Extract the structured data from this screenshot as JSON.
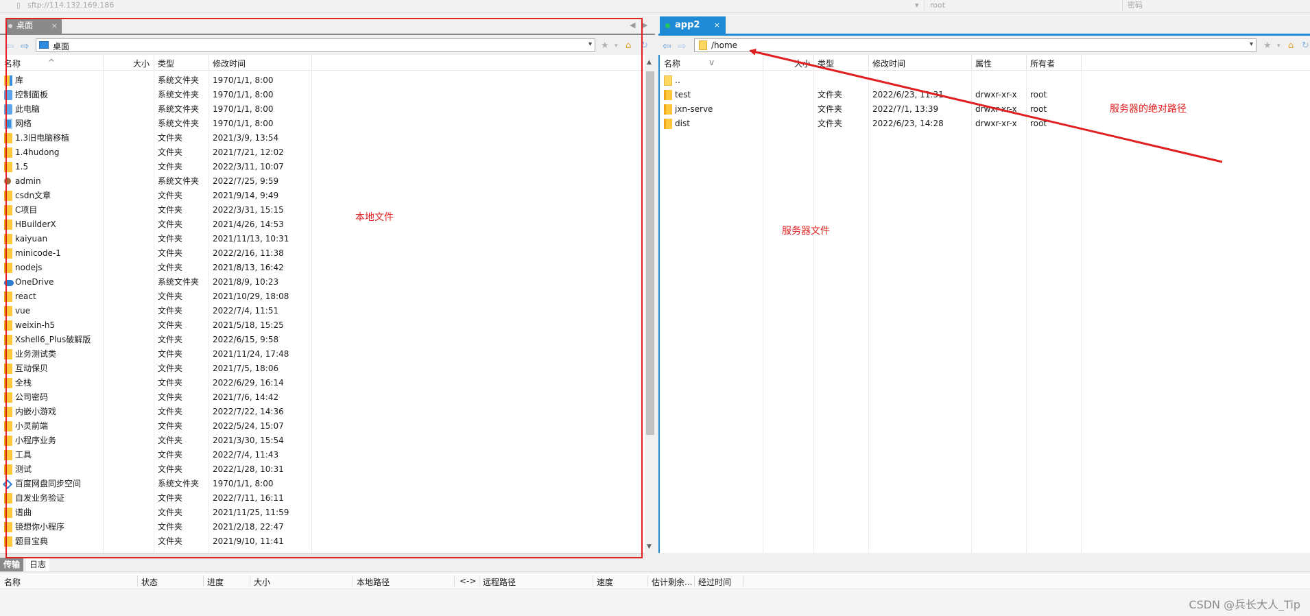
{
  "top_bar": {
    "address": "sftp://114.132.169.186",
    "user": "root",
    "password_label": "密码"
  },
  "local_tab": {
    "label": "桌面",
    "close": "×"
  },
  "remote_tab": {
    "label": "app2",
    "close": "×"
  },
  "local_path": "桌面",
  "remote_path": "/home",
  "columns_local": {
    "name": "名称",
    "size": "大小",
    "type": "类型",
    "modified": "修改时间"
  },
  "columns_remote": {
    "name": "名称",
    "size": "大小",
    "type": "类型",
    "modified": "修改时间",
    "attrs": "属性",
    "owner": "所有者"
  },
  "local_files": [
    {
      "name": "库",
      "type": "系统文件夹",
      "modified": "1970/1/1, 8:00",
      "icon": "lib"
    },
    {
      "name": "控制面板",
      "type": "系统文件夹",
      "modified": "1970/1/1, 8:00",
      "icon": "sys"
    },
    {
      "name": "此电脑",
      "type": "系统文件夹",
      "modified": "1970/1/1, 8:00",
      "icon": "sys"
    },
    {
      "name": "网络",
      "type": "系统文件夹",
      "modified": "1970/1/1, 8:00",
      "icon": "net"
    },
    {
      "name": "1.3旧电脑移植",
      "type": "文件夹",
      "modified": "2021/3/9, 13:54",
      "icon": "folder"
    },
    {
      "name": "1.4hudong",
      "type": "文件夹",
      "modified": "2021/7/21, 12:02",
      "icon": "folder"
    },
    {
      "name": "1.5",
      "type": "文件夹",
      "modified": "2022/3/11, 10:07",
      "icon": "folder"
    },
    {
      "name": "admin",
      "type": "系统文件夹",
      "modified": "2022/7/25, 9:59",
      "icon": "user"
    },
    {
      "name": "csdn文章",
      "type": "文件夹",
      "modified": "2021/9/14, 9:49",
      "icon": "folder"
    },
    {
      "name": "C项目",
      "type": "文件夹",
      "modified": "2022/3/31, 15:15",
      "icon": "folder"
    },
    {
      "name": "HBuilderX",
      "type": "文件夹",
      "modified": "2021/4/26, 14:53",
      "icon": "folder"
    },
    {
      "name": "kaiyuan",
      "type": "文件夹",
      "modified": "2021/11/13, 10:31",
      "icon": "folder"
    },
    {
      "name": "minicode-1",
      "type": "文件夹",
      "modified": "2022/2/16, 11:38",
      "icon": "folder"
    },
    {
      "name": "nodejs",
      "type": "文件夹",
      "modified": "2021/8/13, 16:42",
      "icon": "folder"
    },
    {
      "name": "OneDrive",
      "type": "系统文件夹",
      "modified": "2021/8/9, 10:23",
      "icon": "cloud"
    },
    {
      "name": "react",
      "type": "文件夹",
      "modified": "2021/10/29, 18:08",
      "icon": "folder"
    },
    {
      "name": "vue",
      "type": "文件夹",
      "modified": "2022/7/4, 11:51",
      "icon": "folder"
    },
    {
      "name": "weixin-h5",
      "type": "文件夹",
      "modified": "2021/5/18, 15:25",
      "icon": "folder"
    },
    {
      "name": "Xshell6_Plus破解版",
      "type": "文件夹",
      "modified": "2022/6/15, 9:58",
      "icon": "folder"
    },
    {
      "name": "业务测试类",
      "type": "文件夹",
      "modified": "2021/11/24, 17:48",
      "icon": "folder"
    },
    {
      "name": "互动保贝",
      "type": "文件夹",
      "modified": "2021/7/5, 18:06",
      "icon": "folder"
    },
    {
      "name": "全栈",
      "type": "文件夹",
      "modified": "2022/6/29, 16:14",
      "icon": "folder"
    },
    {
      "name": "公司密码",
      "type": "文件夹",
      "modified": "2021/7/6, 14:42",
      "icon": "folder"
    },
    {
      "name": "内嵌小游戏",
      "type": "文件夹",
      "modified": "2022/7/22, 14:36",
      "icon": "folder"
    },
    {
      "name": "小灵前端",
      "type": "文件夹",
      "modified": "2022/5/24, 15:07",
      "icon": "folder"
    },
    {
      "name": "小程序业务",
      "type": "文件夹",
      "modified": "2021/3/30, 15:54",
      "icon": "folder"
    },
    {
      "name": "工具",
      "type": "文件夹",
      "modified": "2022/7/4, 11:43",
      "icon": "folder"
    },
    {
      "name": "测试",
      "type": "文件夹",
      "modified": "2022/1/28, 10:31",
      "icon": "folder"
    },
    {
      "name": "百度网盘同步空间",
      "type": "系统文件夹",
      "modified": "1970/1/1, 8:00",
      "icon": "baidu"
    },
    {
      "name": "自发业务验证",
      "type": "文件夹",
      "modified": "2022/7/11, 16:11",
      "icon": "folder"
    },
    {
      "name": "谱曲",
      "type": "文件夹",
      "modified": "2021/11/25, 11:59",
      "icon": "folder"
    },
    {
      "name": "镜想你小程序",
      "type": "文件夹",
      "modified": "2021/2/18, 22:47",
      "icon": "folder"
    },
    {
      "name": "题目宝典",
      "type": "文件夹",
      "modified": "2021/9/10, 11:41",
      "icon": "folder"
    }
  ],
  "remote_files": [
    {
      "name": "..",
      "type": "",
      "modified": "",
      "attrs": "",
      "owner": "",
      "icon": "updir"
    },
    {
      "name": "test",
      "type": "文件夹",
      "modified": "2022/6/23, 11:31",
      "attrs": "drwxr-xr-x",
      "owner": "root",
      "icon": "folder"
    },
    {
      "name": "jxn-serve",
      "type": "文件夹",
      "modified": "2022/7/1, 13:39",
      "attrs": "drwxr-xr-x",
      "owner": "root",
      "icon": "folder"
    },
    {
      "name": "dist",
      "type": "文件夹",
      "modified": "2022/6/23, 14:28",
      "attrs": "drwxr-xr-x",
      "owner": "root",
      "icon": "folder"
    }
  ],
  "bottom_tabs": {
    "transfer": "传输",
    "log": "日志"
  },
  "transfer_columns": {
    "name": "名称",
    "status": "状态",
    "progress": "进度",
    "size": "大小",
    "local_path": "本地路径",
    "direction": "<->",
    "remote_path": "远程路径",
    "speed": "速度",
    "eta": "估计剩余...",
    "elapsed": "经过时间"
  },
  "annotations": {
    "local_files": "本地文件",
    "server_files": "服务器文件",
    "absolute_path": "服务器的绝对路径",
    "annotation_color": "#e02020"
  },
  "watermark": "CSDN @兵长大人_Tip"
}
